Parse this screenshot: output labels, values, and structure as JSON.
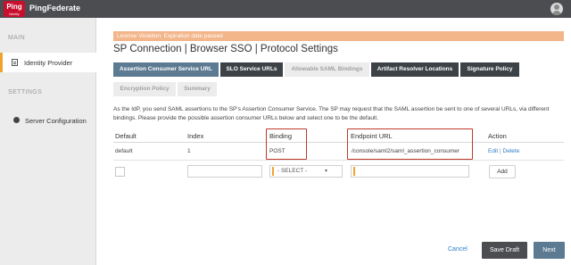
{
  "header": {
    "logo_text": "Ping",
    "logo_subtext": "Identity",
    "product_name": "PingFederate",
    "user_icon": "user-avatar-icon"
  },
  "sidebar": {
    "main_label": "MAIN",
    "settings_label": "SETTINGS",
    "items": [
      {
        "label": "Identity Provider",
        "icon": "document-icon",
        "active": true
      },
      {
        "label": "Server Configuration",
        "icon": "gear-icon",
        "active": false
      }
    ]
  },
  "alert": {
    "text": "License Violation: Expiration date passed"
  },
  "page": {
    "title": "SP Connection | Browser SSO | Protocol Settings"
  },
  "tabs": [
    {
      "label": "Assertion Consumer Service URL",
      "state": "active"
    },
    {
      "label": "SLO Service URLs",
      "state": "enabled"
    },
    {
      "label": "Allowable SAML Bindings",
      "state": "disabled"
    },
    {
      "label": "Artifact Resolver Locations",
      "state": "enabled"
    },
    {
      "label": "Signature Policy",
      "state": "enabled"
    },
    {
      "label": "Encryption Policy",
      "state": "disabled"
    },
    {
      "label": "Summary",
      "state": "disabled"
    }
  ],
  "description": "As the IdP, you send SAML assertions to the SP's Assertion Consumer Service. The SP may request that the SAML assertion be sent to one of several URLs, via different bindings. Please provide the possible assertion consumer URLs below and select one to be the default.",
  "table": {
    "columns": [
      "Default",
      "Index",
      "Binding",
      "Endpoint URL",
      "Action"
    ],
    "rows": [
      {
        "default": "default",
        "index": "1",
        "binding": "POST",
        "endpoint_url": "/console/saml2/saml_assertion_consumer",
        "edit_label": "Edit",
        "separator": "|",
        "delete_label": "Delete"
      }
    ],
    "new_row": {
      "index_value": "",
      "binding_value": "- SELECT -",
      "endpoint_value": "",
      "add_label": "Add"
    }
  },
  "footer": {
    "cancel_label": "Cancel",
    "save_draft_label": "Save Draft",
    "next_label": "Next"
  },
  "colors": {
    "topbar": "#4b4d50",
    "brand_red": "#c8102e",
    "accent_orange": "#f0a430",
    "active_tab": "#5c7a91",
    "dark_tab": "#3d4247",
    "alert": "#f3b58a",
    "link": "#2d7fc9",
    "highlight_border": "#c0392b"
  }
}
